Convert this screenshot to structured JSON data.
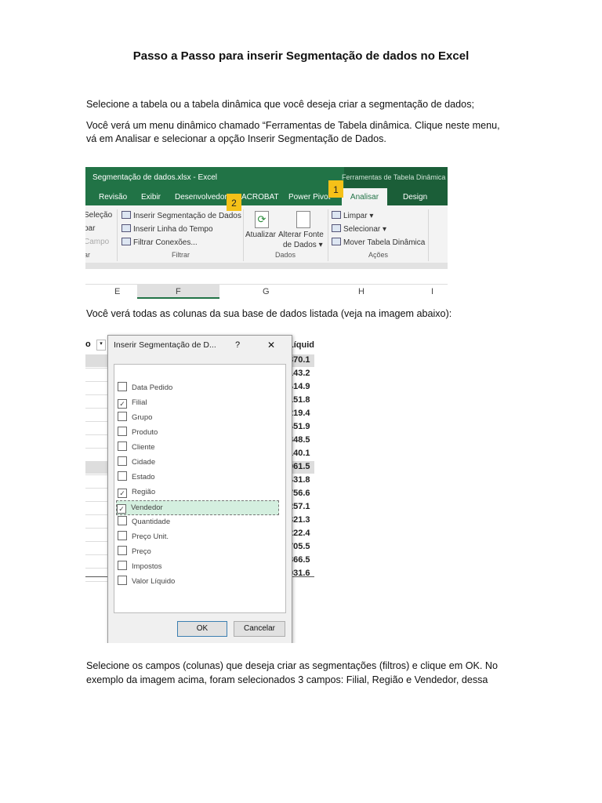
{
  "title": "Passo a Passo para inserir Segmentação de dados no Excel",
  "paragraphs": [
    "Selecione a tabela ou a tabela dinâmica que você deseja criar a segmentação de dados;",
    "Você verá um menu dinâmico chamado “Ferramentas de Tabela dinâmica. Clique neste menu,",
    "vá em Analisar e selecionar a opção Inserir Segmentação de Dados.",
    "Você verá todas as colunas da sua base de dados listada (veja na imagem abaixo):",
    "Selecione os campos (colunas) que deseja criar as segmentações (filtros) e clique em OK. No",
    "exemplo da imagem acima, foram selecionados 3 campos: Filial, Região e Vendedor, dessa"
  ],
  "ribbon": {
    "window_title": "Segmentação de dados.xlsx  -  Excel",
    "context_title": "Ferramentas de Tabela Dinâmica",
    "tabs": [
      "Revisão",
      "Exibir",
      "Desenvolvedor",
      "ACROBAT",
      "Power Pivot",
      "Analisar",
      "Design"
    ],
    "badges": [
      "1",
      "2"
    ],
    "left_partial": [
      "Seleção",
      "par",
      "Campo",
      "ar"
    ],
    "filtrar": [
      "Inserir Segmentação de Dados",
      "Inserir Linha do Tempo",
      "Filtrar Conexões..."
    ],
    "dados": [
      "Atualizar",
      "Alterar Fonte",
      "de Dados ▾"
    ],
    "acoes": [
      "Limpar ▾",
      "Selecionar ▾",
      "Mover Tabela Dinâmica"
    ],
    "groups": [
      "Filtrar",
      "Dados",
      "Ações"
    ],
    "columns": [
      "E",
      "F",
      "G",
      "H",
      "I"
    ]
  },
  "dialog": {
    "title": "Inserir Segmentação de D...",
    "help": "?",
    "close": "✕",
    "fields": [
      {
        "label": "Data Pedido",
        "checked": false
      },
      {
        "label": "Filial",
        "checked": true
      },
      {
        "label": "Grupo",
        "checked": false
      },
      {
        "label": "Produto",
        "checked": false
      },
      {
        "label": "Cliente",
        "checked": false
      },
      {
        "label": "Cidade",
        "checked": false
      },
      {
        "label": "Estado",
        "checked": false
      },
      {
        "label": "Região",
        "checked": true
      },
      {
        "label": "Vendedor",
        "checked": true
      },
      {
        "label": "Quantidade",
        "checked": false
      },
      {
        "label": "Preço Unit.",
        "checked": false
      },
      {
        "label": "Preço",
        "checked": false
      },
      {
        "label": "Impostos",
        "checked": false
      },
      {
        "label": "Valor Líquido",
        "checked": false
      }
    ],
    "ok": "OK",
    "cancel": "Cancelar"
  },
  "sheet": {
    "left_header": "o",
    "right_header": "Líquid",
    "values": [
      "870.1",
      "143.2",
      "414.9",
      "151.8",
      "219.4",
      "451.9",
      "348.5",
      "140.1",
      "061.5",
      "431.8",
      "756.6",
      "257.1",
      "321.3",
      "222.4",
      "705.5",
      "366.5",
      "931.6"
    ]
  }
}
